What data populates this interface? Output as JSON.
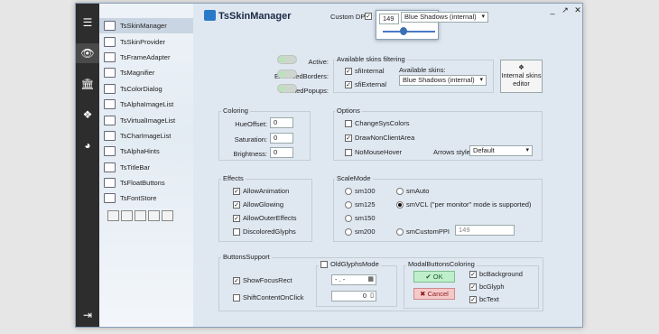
{
  "window": {
    "title": "TsSkinManager",
    "controls": {
      "minimize": "_",
      "maximize": "↗",
      "close": "✕"
    }
  },
  "leftbar": {
    "icons": [
      "menu-icon",
      "eye-slash-icon",
      "bank-icon",
      "dropbox-icon",
      "dashboard-icon",
      "logout-icon"
    ]
  },
  "sidebar": {
    "items": [
      {
        "label": "TsSkinManager",
        "selected": true
      },
      {
        "label": "TsSkinProvider"
      },
      {
        "label": "TsFrameAdapter"
      },
      {
        "label": "TsMagnifier"
      },
      {
        "label": "TsColorDialog"
      },
      {
        "label": "TsAlphaImageList"
      },
      {
        "label": "TsVirtualImageList"
      },
      {
        "label": "TsCharImageList"
      },
      {
        "label": "TsAlphaHints"
      },
      {
        "label": "TsTitleBar"
      },
      {
        "label": "TsFloatButtons"
      },
      {
        "label": "TsFontStore"
      }
    ]
  },
  "header": {
    "custom_dpi_label": "Custom DPI:",
    "dpi_value": "149",
    "skin_select": "Blue Shadows (internal)"
  },
  "toggles": [
    {
      "label": "Active:"
    },
    {
      "label": "ExtendedBorders:"
    },
    {
      "label": "SkinnedPopups:"
    }
  ],
  "filtering": {
    "title": "Available skins filtering",
    "sfi_internal": "sfiInternal",
    "sfi_external": "sfiExternal",
    "available_label": "Available skins:",
    "available_value": "Blue Shadows (internal)",
    "editor_btn": "Internal skins editor"
  },
  "coloring": {
    "title": "Coloring",
    "hue_label": "HueOffset:",
    "hue_value": "0",
    "sat_label": "Saturation:",
    "sat_value": "0",
    "bri_label": "Brightness:",
    "bri_value": "0"
  },
  "options": {
    "title": "Options",
    "change_sys": "ChangeSysColors",
    "draw_non": "DrawNonClientArea",
    "no_mouse": "NoMouseHover",
    "arrows_label": "Arrows style:",
    "arrows_value": "Default"
  },
  "effects": {
    "title": "Effects",
    "items": [
      "AllowAnimation",
      "AllowGlowing",
      "AllowOuterEffects",
      "DiscoloredGlyphs"
    ]
  },
  "scalemode": {
    "title": "ScaleMode",
    "sm100": "sm100",
    "smAuto": "smAuto",
    "sm125": "sm125",
    "smVCL": "smVCL (\"per monitor\" mode is supported)",
    "sm150": "sm150",
    "sm200": "sm200",
    "smCustomPPI": "smCustomPPI",
    "ppi_value": "149"
  },
  "buttons_support": {
    "title": "ButtonsSupport",
    "show_focus": "ShowFocusRect",
    "shift_content": "ShiftContentOnClick"
  },
  "old_glyphs": {
    "title": "OldGlyphsMode",
    "date_value": "- . -",
    "spin_value": "0"
  },
  "modal_coloring": {
    "title": "ModalButtonsColoring",
    "ok": "OK",
    "cancel": "Cancel",
    "bg": "bcBackground",
    "glyph": "bcGlyph",
    "text": "bcText"
  }
}
